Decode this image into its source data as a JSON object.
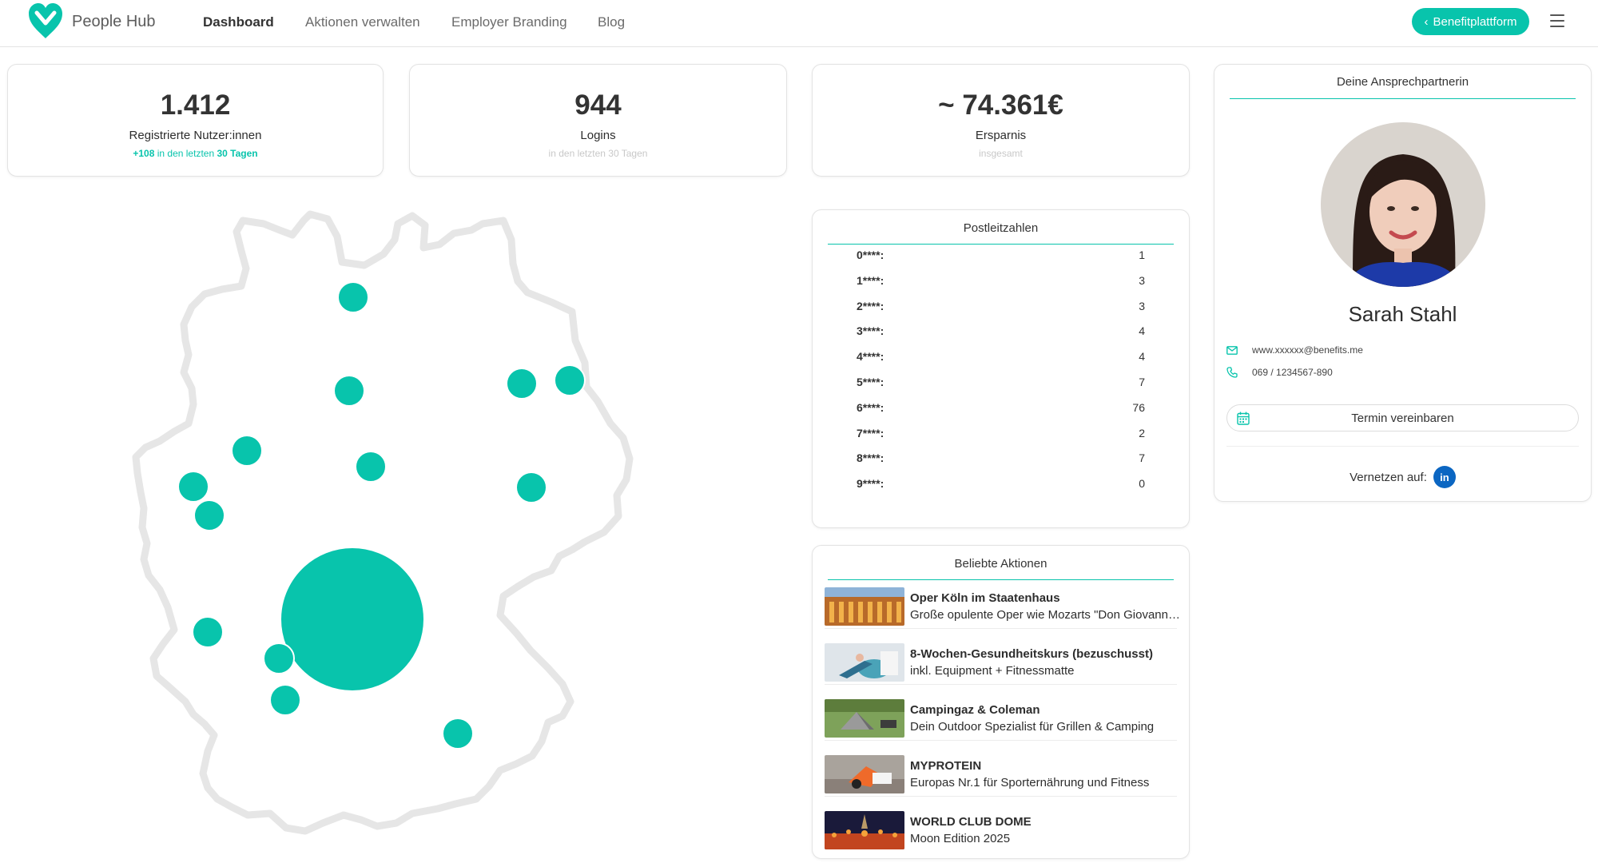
{
  "brand": {
    "name": "People Hub"
  },
  "nav": {
    "items": [
      {
        "label": "Dashboard",
        "active": true
      },
      {
        "label": "Aktionen verwalten"
      },
      {
        "label": "Employer Branding"
      },
      {
        "label": "Blog"
      }
    ],
    "platform_button": "Benefitplattform"
  },
  "colors": {
    "accent": "#08c4ac",
    "linkedin": "#0b66c2"
  },
  "stats": [
    {
      "value": "1.412",
      "label": "Registrierte Nutzer:innen",
      "sub_prefix": "+108",
      "sub_mid": " in den letzten ",
      "sub_bold": "30 Tagen"
    },
    {
      "value": "944",
      "label": "Logins",
      "sub": "in den letzten 30 Tagen"
    },
    {
      "value": "~ 74.361€",
      "label": "Ersparnis",
      "sub": "insgesamt"
    }
  ],
  "postleitzahlen": {
    "title": "Postleitzahlen",
    "rows": [
      {
        "key": "0****:",
        "count": "1"
      },
      {
        "key": "1****:",
        "count": "3"
      },
      {
        "key": "2****:",
        "count": "3"
      },
      {
        "key": "3****:",
        "count": "4"
      },
      {
        "key": "4****:",
        "count": "4"
      },
      {
        "key": "5****:",
        "count": "7"
      },
      {
        "key": "6****:",
        "count": "76"
      },
      {
        "key": "7****:",
        "count": "2"
      },
      {
        "key": "8****:",
        "count": "7"
      },
      {
        "key": "9****:",
        "count": "0"
      }
    ]
  },
  "aktionen": {
    "title": "Beliebte Aktionen",
    "items": [
      {
        "title": "Oper Köln im Staatenhaus",
        "desc": "Große opulente Oper wie Mozarts \"Don Giovanni\" und viele mehr"
      },
      {
        "title": "8-Wochen-Gesundheitskurs (bezuschusst)",
        "desc": "inkl. Equipment + Fitnessmatte"
      },
      {
        "title": "Campingaz & Coleman",
        "desc": "Dein Outdoor Spezialist für Grillen & Camping"
      },
      {
        "title": "MYPROTEIN",
        "desc": "Europas Nr.1 für Sporternährung und Fitness"
      },
      {
        "title": "WORLD CLUB DOME",
        "desc": "Moon Edition 2025"
      }
    ]
  },
  "contact": {
    "title": "Deine Ansprechpartnerin",
    "name": "Sarah Stahl",
    "email": "www.xxxxxx@benefits.me",
    "phone": "069 / 1234567-890",
    "appointment_button": "Termin vereinbaren",
    "network_label": "Vernetzen auf:",
    "linkedin_glyph": "in"
  },
  "map": {
    "points": [
      {
        "region": "0"
      },
      {
        "region": "1"
      },
      {
        "region": "2"
      },
      {
        "region": "3"
      },
      {
        "region": "4"
      },
      {
        "region": "5"
      },
      {
        "region": "6"
      },
      {
        "region": "7"
      },
      {
        "region": "8"
      }
    ]
  }
}
